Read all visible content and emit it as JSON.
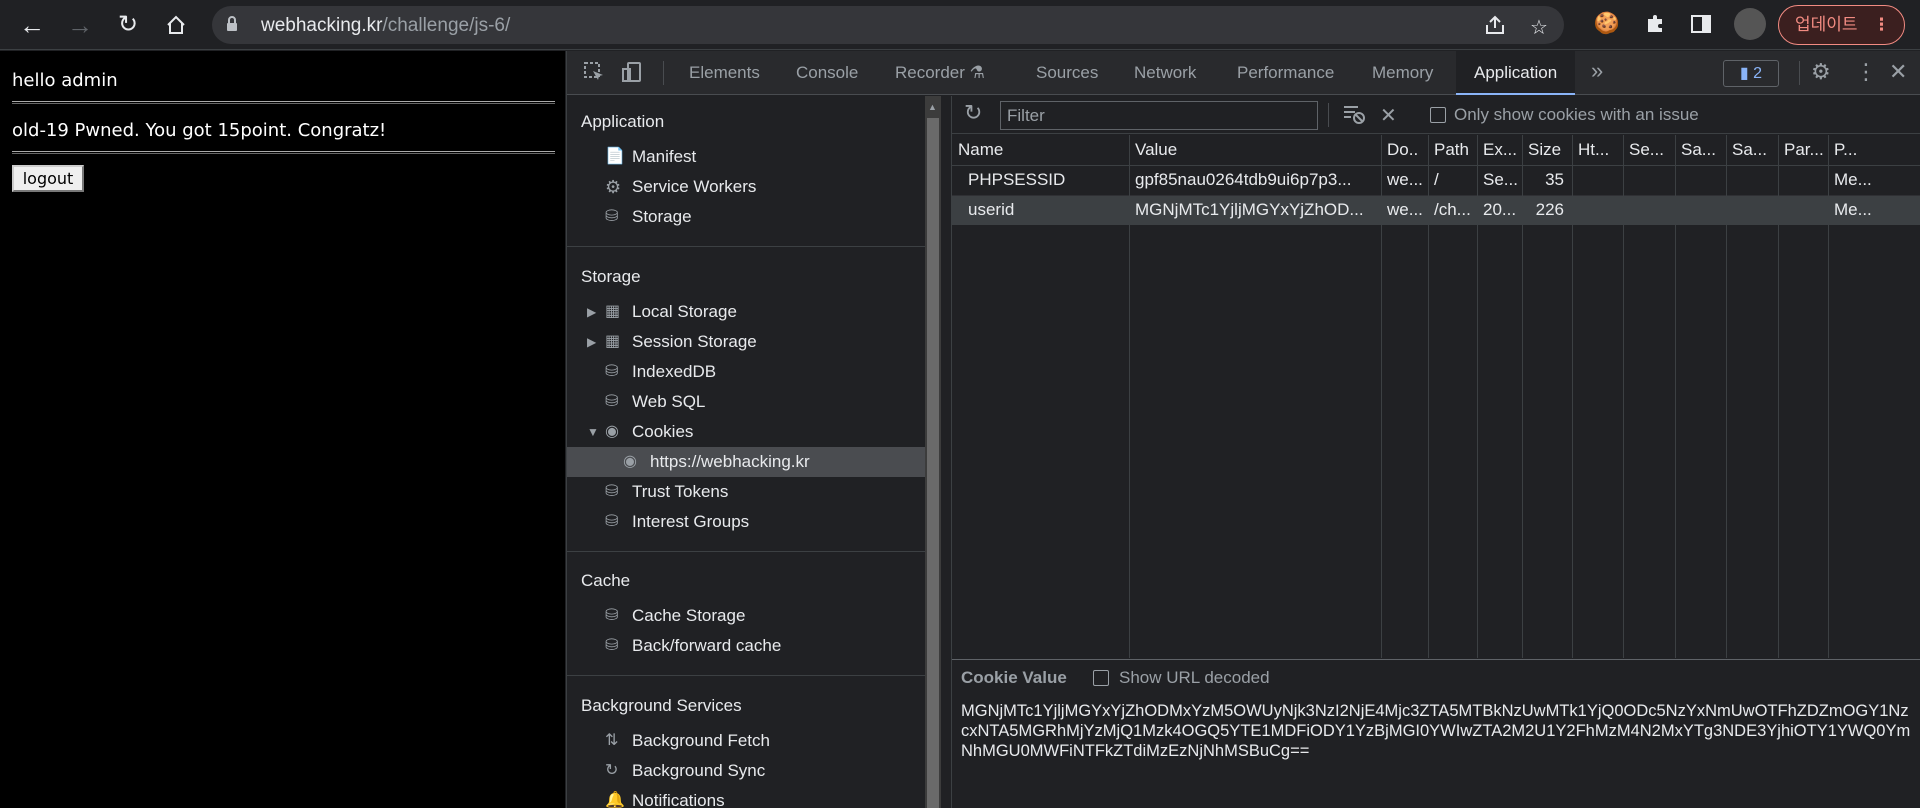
{
  "browser": {
    "url_host": "webhacking.kr",
    "url_path": "/challenge/js-6/",
    "update_label": "업데이트"
  },
  "page": {
    "greeting": "hello admin",
    "message": "old-19 Pwned. You got 15point. Congratz!",
    "logout_label": "logout"
  },
  "devtools": {
    "tabs": [
      "Elements",
      "Console",
      "Recorder",
      "Sources",
      "Network",
      "Performance",
      "Memory",
      "Application"
    ],
    "active_tab": "Application",
    "issues_count": "2",
    "sidebar": {
      "application_title": "Application",
      "application_items": [
        "Manifest",
        "Service Workers",
        "Storage"
      ],
      "storage_title": "Storage",
      "storage_items": [
        "Local Storage",
        "Session Storage",
        "IndexedDB",
        "Web SQL",
        "Cookies",
        "https://webhacking.kr",
        "Trust Tokens",
        "Interest Groups"
      ],
      "cache_title": "Cache",
      "cache_items": [
        "Cache Storage",
        "Back/forward cache"
      ],
      "bg_title": "Background Services",
      "bg_items": [
        "Background Fetch",
        "Background Sync",
        "Notifications"
      ]
    },
    "toolbar": {
      "filter_placeholder": "Filter",
      "only_issue_label": "Only show cookies with an issue"
    },
    "grid": {
      "headers": [
        "Name",
        "Value",
        "Do..",
        "Path",
        "Ex...",
        "Size",
        "Ht...",
        "Se...",
        "Sa...",
        "Sa...",
        "Par...",
        "P..."
      ],
      "rows": [
        [
          "PHPSESSID",
          "gpf85nau0264tdb9ui6p7p3...",
          "we...",
          "/",
          "Se...",
          "35",
          "",
          "",
          "",
          "",
          "",
          "Me..."
        ],
        [
          "userid",
          "MGNjMTc1YjljMGYxYjZhOD...",
          "we...",
          "/ch...",
          "20...",
          "226",
          "",
          "",
          "",
          "",
          "",
          "Me..."
        ]
      ]
    },
    "cookie_value": {
      "title": "Cookie Value",
      "show_url_decoded": "Show URL decoded",
      "value": "MGNjMTc1YjljMGYxYjZhODMxYzM5OWUyNjk3NzI2NjE4Mjc3ZTA5MTBkNzUwMTk1YjQ0ODc5NzYxNmUwOTFhZDZmOGY1NzcxNTA5MGRhMjYzMjQ1Mzk4OGQ5YTE1MDFiODY1YzBjMGI0YWIwZTA2M2U1Y2FhMzM4N2MxYTg3NDE3YjhiOTY1YWQ0YmNhMGU0MWFiNTFkZTdiMzEzNjNhMSBuCg=="
    }
  }
}
